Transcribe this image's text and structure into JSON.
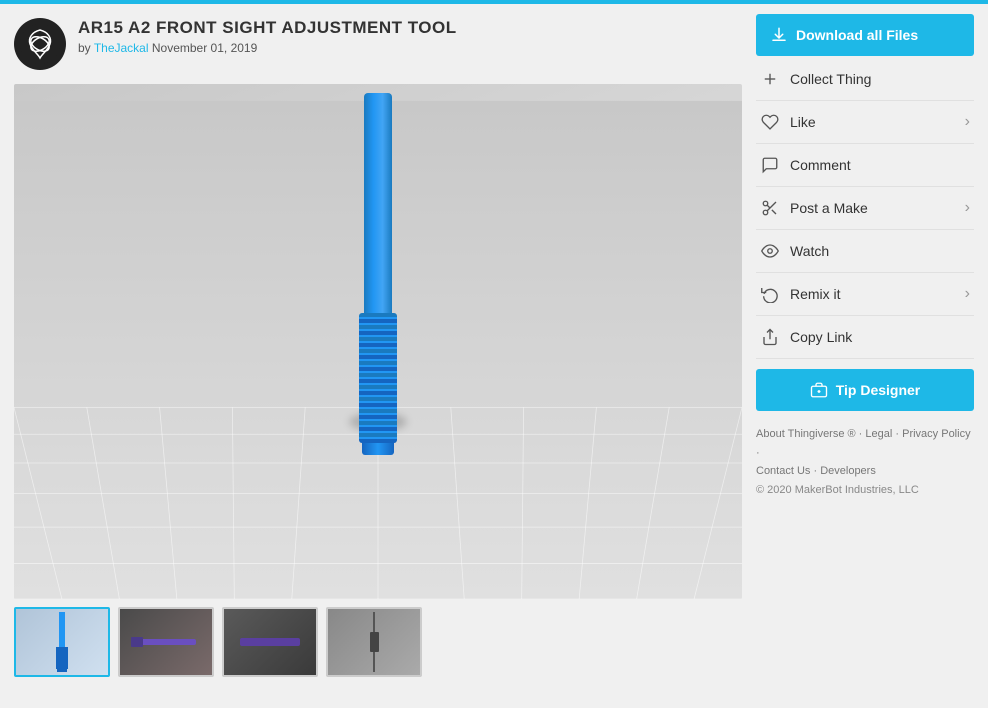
{
  "topbar": {
    "color": "#1eb8e7"
  },
  "header": {
    "title": "AR15 A2 FRONT SIGHT ADJUSTMENT TOOL",
    "author": "TheJackal",
    "date": "November 01, 2019",
    "author_label": "by"
  },
  "actions": {
    "download_label": "Download all Files",
    "collect_label": "Collect Thing",
    "like_label": "Like",
    "comment_label": "Comment",
    "post_make_label": "Post a Make",
    "watch_label": "Watch",
    "remix_label": "Remix it",
    "copy_link_label": "Copy Link",
    "tip_label": "Tip Designer"
  },
  "footer": {
    "about": "About Thingiverse ®",
    "legal": "Legal",
    "privacy": "Privacy Policy",
    "contact": "Contact Us",
    "developers": "Developers",
    "copyright": "© 2020 MakerBot Industries, LLC"
  },
  "thumbnails": [
    {
      "id": 1,
      "active": true
    },
    {
      "id": 2,
      "active": false
    },
    {
      "id": 3,
      "active": false
    },
    {
      "id": 4,
      "active": false
    }
  ]
}
